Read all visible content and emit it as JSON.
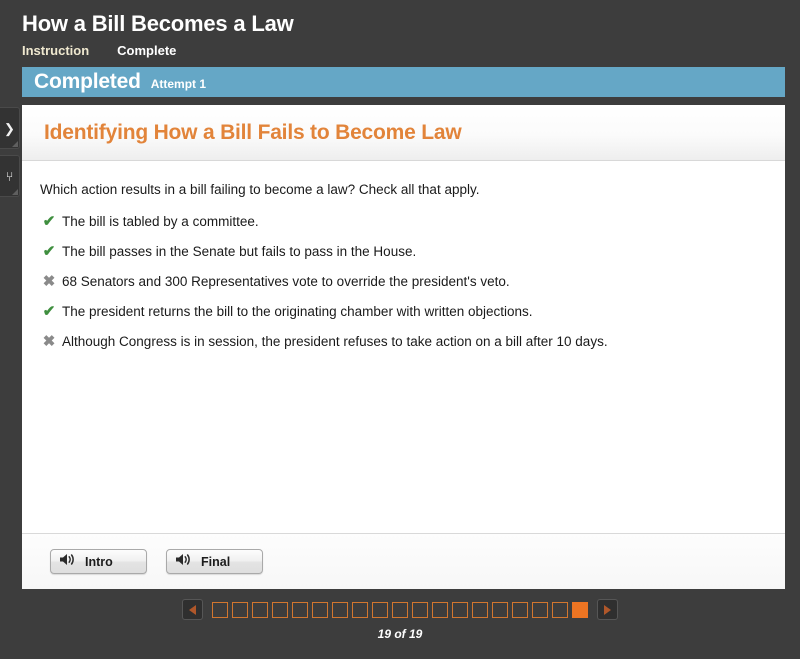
{
  "header": {
    "course_title": "How a Bill Becomes a Law",
    "breadcrumbs": [
      {
        "label": "Instruction",
        "active": true
      },
      {
        "label": "Complete",
        "active": false
      }
    ]
  },
  "status_banner": {
    "status_label": "Completed",
    "attempt_label": "Attempt 1",
    "background_color": "#65a7c6"
  },
  "side_tabs": [
    {
      "name": "expand-panel-tab",
      "glyph": "❯"
    },
    {
      "name": "collapse-panel-tab",
      "glyph": "⑂"
    }
  ],
  "lesson": {
    "title": "Identifying How a Bill Fails to Become Law",
    "title_color": "#e2843a",
    "question_prompt": "Which action results in a bill failing to become a law? Check all that apply.",
    "answers": [
      {
        "marker": "✔",
        "state": "correct",
        "text": "The bill is tabled by a committee."
      },
      {
        "marker": "✔",
        "state": "correct",
        "text": "The bill passes in the Senate but fails to pass in the House."
      },
      {
        "marker": "✖",
        "state": "incorrect",
        "text": "68 Senators and 300 Representatives vote to override the president's veto."
      },
      {
        "marker": "✔",
        "state": "correct",
        "text": "The president returns the bill to the originating chamber with written objections."
      },
      {
        "marker": "✖",
        "state": "incorrect",
        "text": "Although Congress is in session, the president refuses to take action on a bill after 10 days."
      }
    ]
  },
  "audio_buttons": [
    {
      "label": "Intro",
      "icon": "speaker-icon"
    },
    {
      "label": "Final",
      "icon": "speaker-icon"
    }
  ],
  "pagination": {
    "prev_label": "Previous page",
    "next_label": "Next page",
    "total_pages": 19,
    "current_page": 19,
    "count_text": "19 of 19",
    "accent_color": "#ed7523"
  }
}
